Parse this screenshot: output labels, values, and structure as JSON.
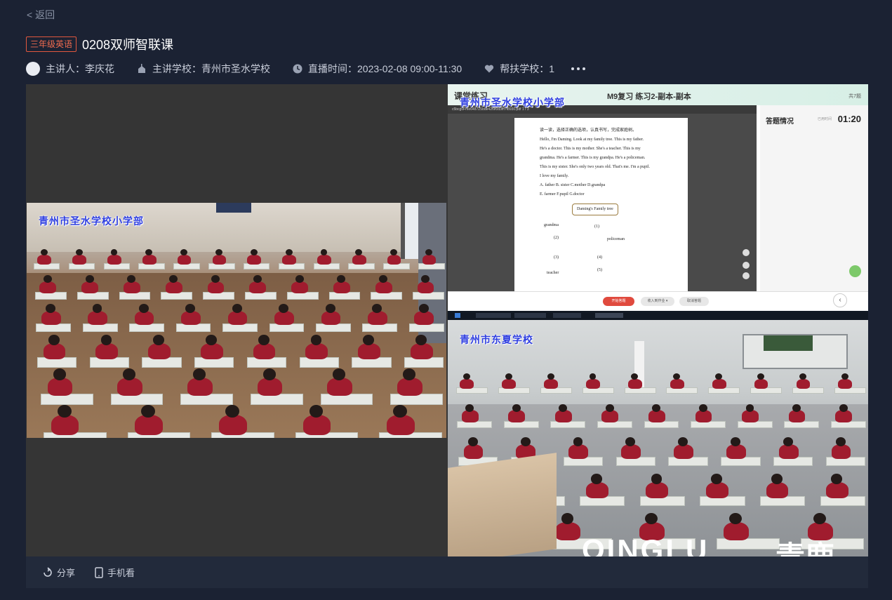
{
  "nav": {
    "back_label": "< 返回"
  },
  "course": {
    "tag": "三年级英语",
    "title": "0208双师智联课"
  },
  "meta": {
    "speaker": "主讲人：李庆花",
    "school": "主讲学校：青州市圣水学校",
    "time": "直播时间：2023-02-08 09:00-11:30",
    "support": "帮扶学校：1"
  },
  "player": {
    "left_camera_label": "青州市圣水学校小学部",
    "right_top_camera_label": "青州市圣水学校小学部",
    "right_bottom_camera_label": "青州市东夏学校",
    "slide": {
      "header_left": "课堂练习",
      "header_title": "M9复习 练习2-副本-副本",
      "page_count": "共7题",
      "doc_bar": "c5bcg0Fme6487Z5bde42f9f0d3fff7f8930.pdf      1 / 3",
      "answer_label": "答题情况",
      "timer_prefix": "已用时间",
      "timer": "01:20",
      "doc_lines": [
        "读一读，选择正确的选项，认真书写，完成家庭树。",
        "Hello, I'm Daming. Look at my family tree. This is my father.",
        "He's a doctor. This is my mother. She's a teacher. This is my",
        "grandma. He's a farmer. This is my grandpa. He's a policeman.",
        "This is my sister. She's only two years old. That's me. I'm a pupil.",
        "I love my family.",
        "A. father      B. sister      C.mother      D.grandpa",
        "E. farmer      F.pupil       G.doctor"
      ],
      "tree_title": "Daming's Family tree",
      "tree_labels": [
        "grandma",
        "(1)",
        "(2)",
        "policeman",
        "(3)",
        "(4)",
        "(5)",
        "teacher"
      ],
      "footer_buttons": [
        "开始答题",
        "收入到作业 ▾",
        "取消答题"
      ]
    }
  },
  "watermark": {
    "latin": "QINGLU",
    "cn": "青鹿"
  },
  "bottom": {
    "share_label": "分享",
    "mobile_label": "手机看"
  }
}
